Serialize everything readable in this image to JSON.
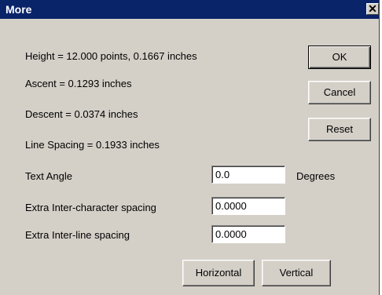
{
  "window": {
    "title": "More",
    "close_glyph": "✕"
  },
  "info": {
    "height": "Height = 12.000 points, 0.1667 inches",
    "ascent": "Ascent = 0.1293 inches",
    "descent": "Descent = 0.0374 inches",
    "line_spacing": "Line Spacing = 0.1933 inches"
  },
  "fields": {
    "text_angle": {
      "label": "Text Angle",
      "value": "0.0",
      "unit": "Degrees"
    },
    "inter_char": {
      "label": "Extra Inter-character spacing",
      "value": "0.0000"
    },
    "inter_line": {
      "label": "Extra Inter-line spacing",
      "value": "0.0000"
    }
  },
  "buttons": {
    "ok": "OK",
    "cancel": "Cancel",
    "reset": "Reset",
    "horizontal": "Horizontal",
    "vertical": "Vertical"
  },
  "colors": {
    "titlebar": "#0a246a",
    "face": "#d4d0c8"
  }
}
